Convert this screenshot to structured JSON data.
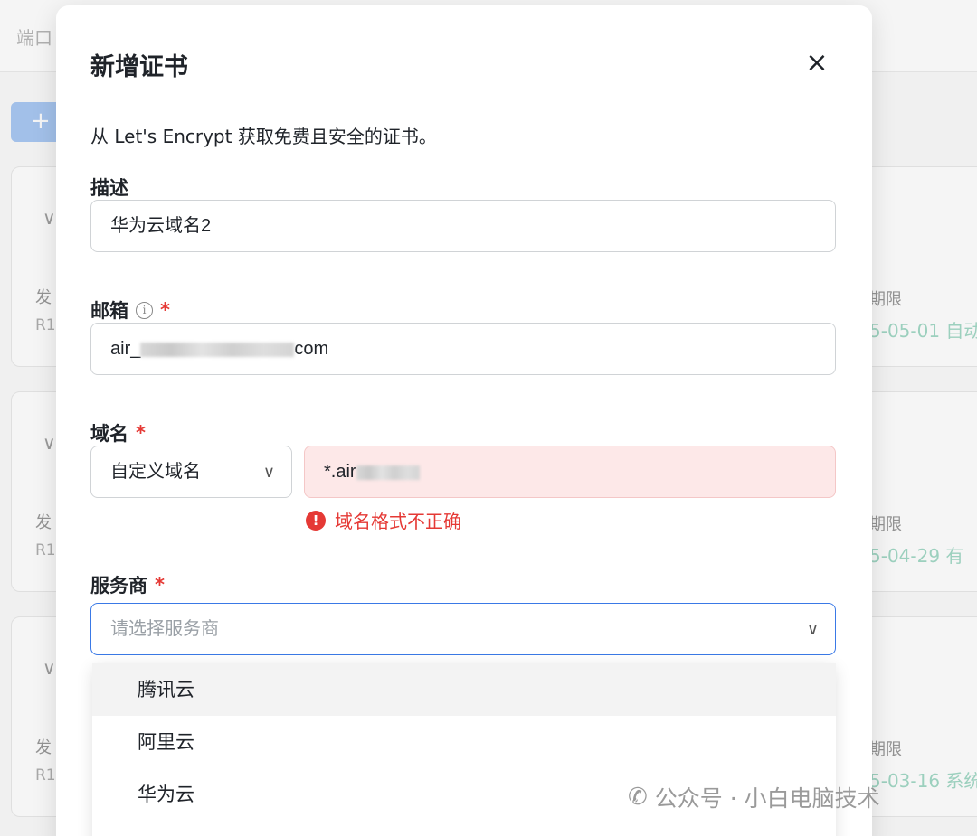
{
  "background": {
    "top_tab_text": "端口",
    "add_button_label": "+",
    "cards": [
      {
        "col1_label": "发",
        "col1_value": "R1",
        "col2_label": "期限",
        "col2_value": "5-05-01 自动"
      },
      {
        "col1_label": "发",
        "col1_value": "R1",
        "col2_label": "期限",
        "col2_value": "5-04-29 有"
      },
      {
        "col1_label": "发",
        "col1_value": "R1",
        "col2_label": "期限",
        "col2_value": "5-03-16 系统"
      }
    ]
  },
  "modal": {
    "title": "新增证书",
    "close_icon": "×",
    "intro": "从 Let's Encrypt 获取免费且安全的证书。",
    "description": {
      "label": "描述",
      "value": "华为云域名2"
    },
    "email": {
      "label": "邮箱",
      "required_mark": "*",
      "value_prefix": "air_",
      "value_suffix": "com"
    },
    "domain": {
      "label": "域名",
      "required_mark": "*",
      "type_value": "自定义域名",
      "domain_value_prefix": "*.air",
      "error_text": "域名格式不正确",
      "error_icon": "!"
    },
    "provider": {
      "label": "服务商",
      "required_mark": "*",
      "placeholder": "请选择服务商",
      "options": [
        "腾讯云",
        "阿里云",
        "华为云"
      ]
    }
  },
  "watermark": {
    "text": "公众号 · 小白电脑技术"
  },
  "colors": {
    "accent": "#3a79e6",
    "error": "#e53935",
    "error_bg": "#fde8e8",
    "status_green": "#a3d9c6"
  }
}
